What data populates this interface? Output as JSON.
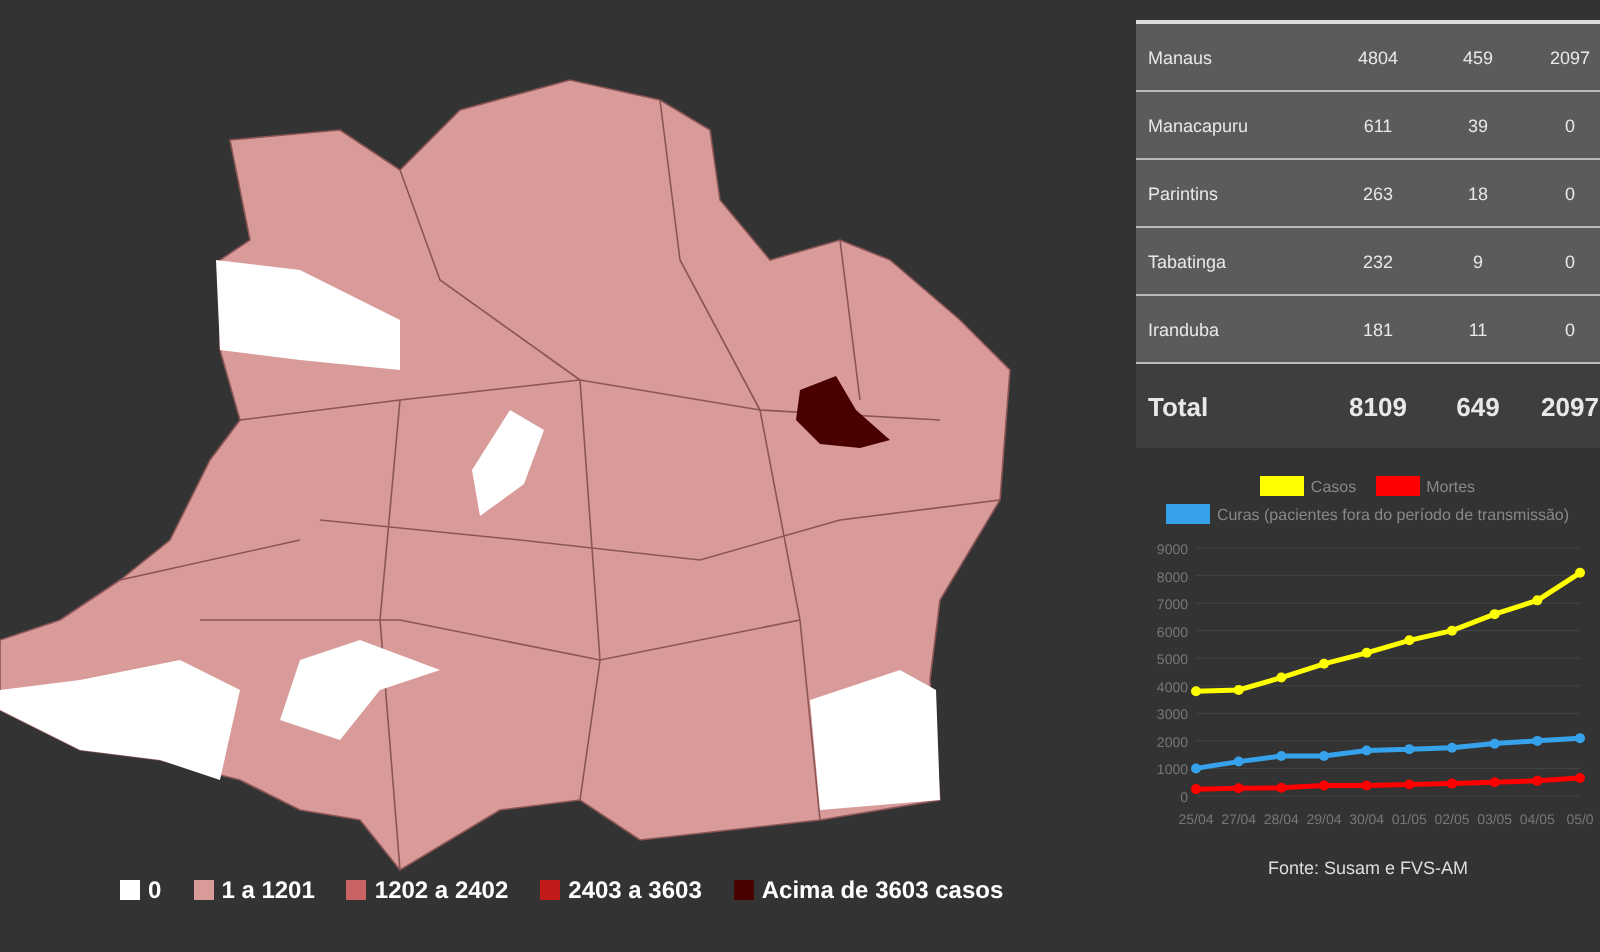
{
  "map": {
    "legend": [
      {
        "label": "0",
        "color": "#ffffff"
      },
      {
        "label": "1 a 1201",
        "color": "#d99a9a"
      },
      {
        "label": "1202 a 2402",
        "color": "#c96464"
      },
      {
        "label": "2403 a 3603",
        "color": "#c01a1a"
      },
      {
        "label": "Acima de 3603 casos",
        "color": "#4a0000"
      }
    ]
  },
  "table": {
    "rows": [
      {
        "cells": [
          "Manaus",
          "4804",
          "459",
          "2097"
        ]
      },
      {
        "cells": [
          "Manacapuru",
          "611",
          "39",
          "0"
        ]
      },
      {
        "cells": [
          "Parintins",
          "263",
          "18",
          "0"
        ]
      },
      {
        "cells": [
          "Tabatinga",
          "232",
          "9",
          "0"
        ]
      },
      {
        "cells": [
          "Iranduba",
          "181",
          "11",
          "0"
        ]
      }
    ],
    "total": [
      "Total",
      "8109",
      "649",
      "2097"
    ]
  },
  "chart": {
    "chart_data": {
      "type": "line",
      "grid": true,
      "categories": [
        "25/04",
        "27/04",
        "28/04",
        "29/04",
        "30/04",
        "01/05",
        "02/05",
        "03/05",
        "04/05",
        "05/0"
      ],
      "ylim": [
        0,
        9000
      ],
      "yticks": [
        0,
        1000,
        2000,
        3000,
        4000,
        5000,
        6000,
        7000,
        8000,
        9000
      ],
      "series": [
        {
          "name": "Casos",
          "color": "#ffff00",
          "marker": true,
          "values": [
            3800,
            3850,
            4300,
            4800,
            5200,
            5650,
            6000,
            6600,
            7100,
            8100
          ]
        },
        {
          "name": "Mortes",
          "color": "#ff0000",
          "marker": true,
          "values": [
            250,
            280,
            300,
            380,
            380,
            420,
            450,
            500,
            550,
            650
          ]
        },
        {
          "name": "Curas (pacientes fora do período de transmissão)",
          "color": "#36a2eb",
          "marker": true,
          "values": [
            1000,
            1250,
            1450,
            1450,
            1650,
            1700,
            1750,
            1900,
            2000,
            2100
          ]
        }
      ]
    },
    "source": "Fonte: Susam e FVS-AM"
  }
}
